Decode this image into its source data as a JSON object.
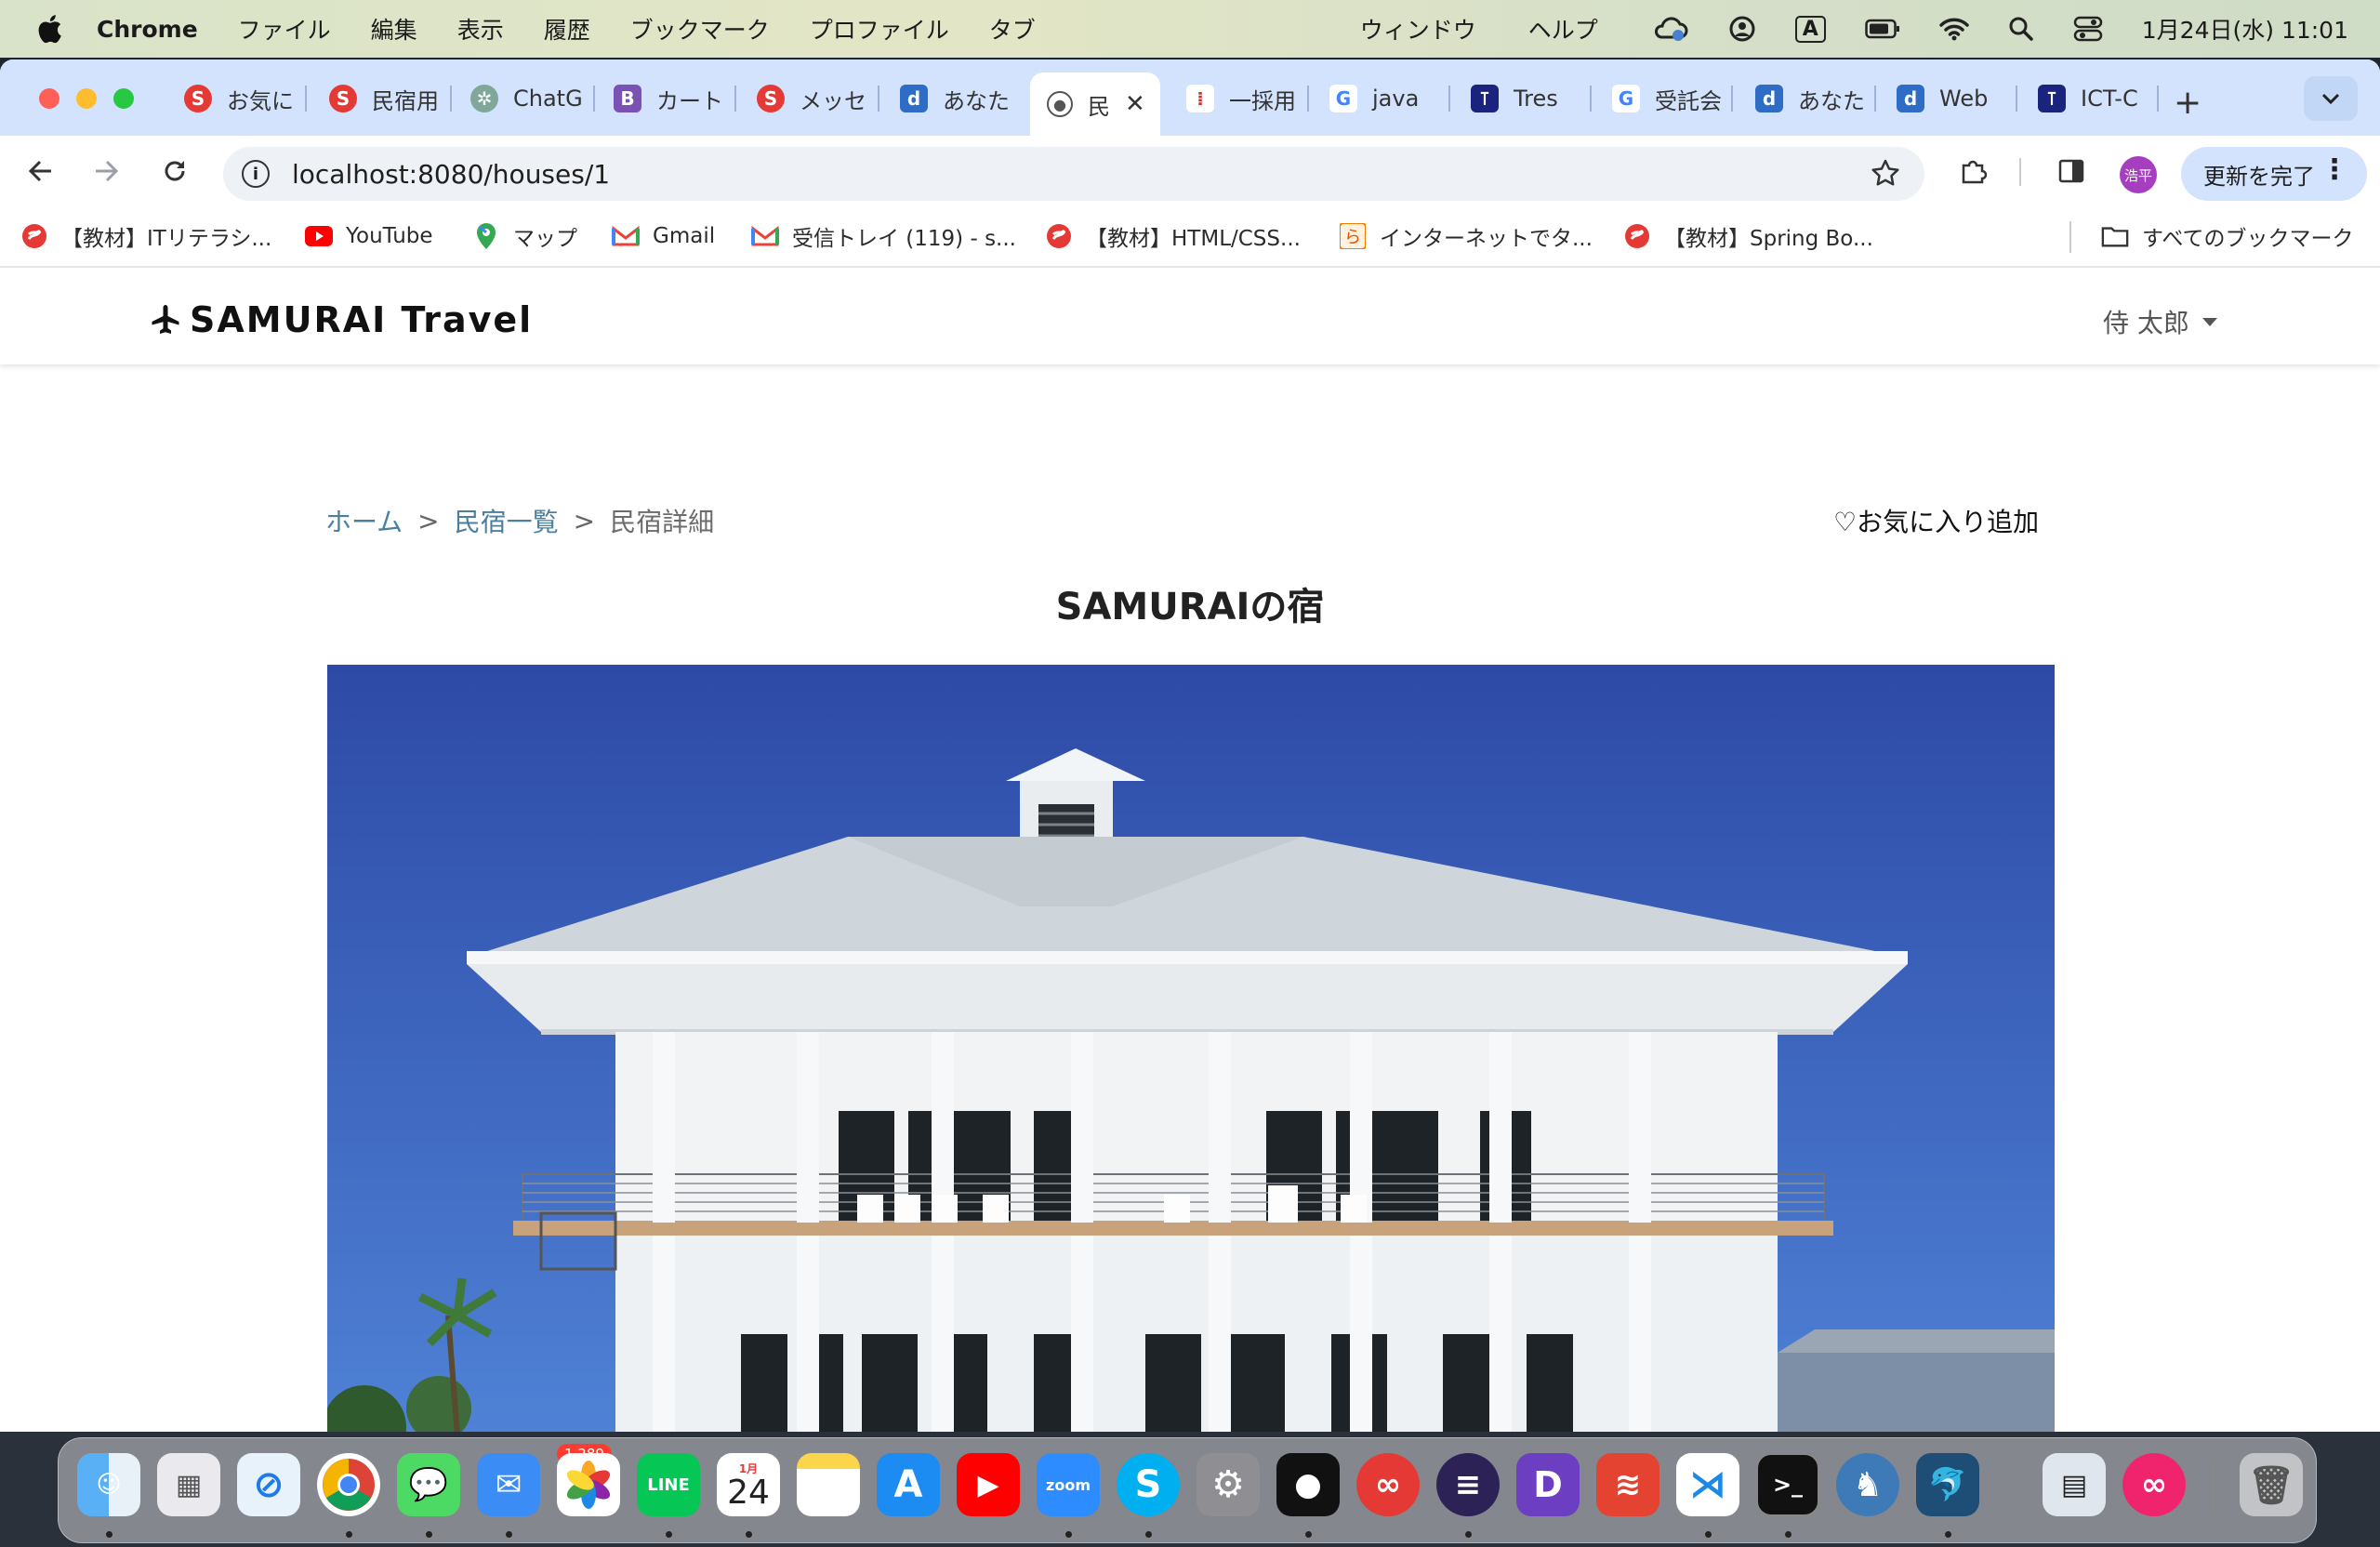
{
  "menubar": {
    "app": "Chrome",
    "items": [
      "ファイル",
      "編集",
      "表示",
      "履歴",
      "ブックマーク",
      "プロファイル",
      "タブ"
    ],
    "right_items": [
      "ウィンドウ",
      "ヘルプ"
    ],
    "input_mode": "A",
    "datetime": "1月24日(水)  11:01"
  },
  "tabs": [
    {
      "label": "お気に",
      "icon": "samurai-icon",
      "color": "#e53935"
    },
    {
      "label": "民宿用",
      "icon": "samurai-icon",
      "color": "#e53935"
    },
    {
      "label": "ChatG",
      "icon": "chatgpt-icon",
      "color": "#7fa89a"
    },
    {
      "label": "カート",
      "icon": "bootstrap-icon",
      "color": "#7952b3"
    },
    {
      "label": "メッセ",
      "icon": "samurai-icon",
      "color": "#e53935"
    },
    {
      "label": "あなた",
      "icon": "d-icon",
      "color": "#2f6cc5"
    },
    {
      "label": "民",
      "icon": "globe-icon",
      "color": "#555555",
      "active": true
    },
    {
      "label": "一採用",
      "icon": "figma-icon",
      "color": "#d03030"
    },
    {
      "label": "java",
      "icon": "google-icon",
      "color": "#4285f4"
    },
    {
      "label": "Tres",
      "icon": "tres-icon",
      "color": "#1a237e"
    },
    {
      "label": "受託会",
      "icon": "google-icon",
      "color": "#4285f4"
    },
    {
      "label": "あなた",
      "icon": "d-icon",
      "color": "#2f6cc5"
    },
    {
      "label": "Web",
      "icon": "d-icon",
      "color": "#2f6cc5"
    },
    {
      "label": "ICT-C",
      "icon": "tres-icon",
      "color": "#1a237e"
    }
  ],
  "toolbar": {
    "url": "localhost:8080/houses/1",
    "avatar_text": "浩平",
    "update_label": "更新を完了"
  },
  "bookmarks": [
    {
      "label": "【教材】ITリテラシ...",
      "icon": "samurai-icon"
    },
    {
      "label": "YouTube",
      "icon": "youtube-icon"
    },
    {
      "label": "マップ",
      "icon": "maps-icon"
    },
    {
      "label": "Gmail",
      "icon": "gmail-icon"
    },
    {
      "label": "受信トレイ (119) - s...",
      "icon": "gmail-icon"
    },
    {
      "label": "【教材】HTML/CSS...",
      "icon": "samurai-icon"
    },
    {
      "label": "インターネットでタ...",
      "icon": "kanji-icon"
    },
    {
      "label": "【教材】Spring Bo...",
      "icon": "samurai-icon"
    }
  ],
  "all_bookmarks": "すべてのブックマーク",
  "site": {
    "logo": "SAMURAI Travel",
    "user": "侍 太郎",
    "breadcrumb": {
      "home": "ホーム",
      "list": "民宿一覧",
      "current": "民宿詳細",
      "sep": ">"
    },
    "favorite": "♡お気に入り追加",
    "house_name": "SAMURAIの宿"
  },
  "dock": {
    "mail_badge": "1,289",
    "calendar_month": "1月",
    "calendar_day": "24",
    "apps": [
      "finder-icon",
      "launchpad-icon",
      "safari-icon",
      "chrome-icon",
      "messages-icon",
      "mail-icon",
      "photos-icon",
      "line-icon",
      "calendar-icon",
      "notes-icon",
      "appstore-icon",
      "youtube-icon",
      "zoom-icon",
      "skype-icon",
      "settings-icon",
      "github-icon",
      "creative-icon",
      "eclipse-icon",
      "d-icon",
      "todoist-icon",
      "vscode-icon",
      "terminal-icon",
      "tableplus-icon",
      "mysql-icon",
      "preview-icon",
      "cc-icon",
      "trash-icon"
    ]
  },
  "colors": {
    "link": "#4a7fa0",
    "tabstrip": "#d3e3fd",
    "sky": "#3a5fb8"
  }
}
